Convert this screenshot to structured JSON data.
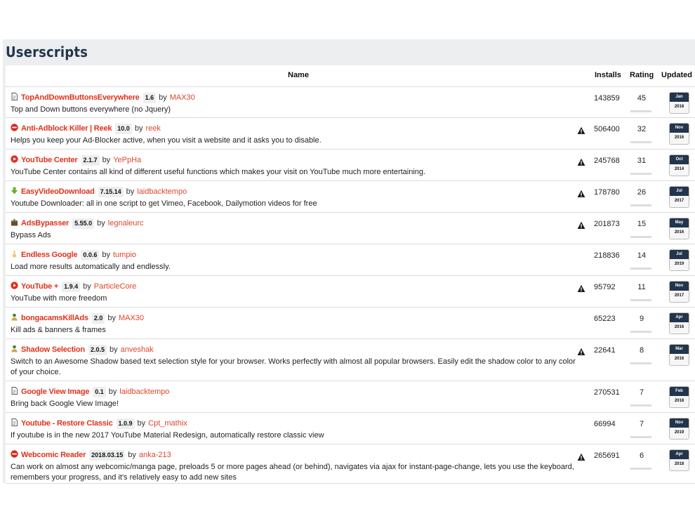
{
  "title": "Userscripts",
  "columns": {
    "name": "Name",
    "installs": "Installs",
    "rating": "Rating",
    "updated": "Updated"
  },
  "colors": {
    "link": "#e0311b",
    "header_bg": "#eceeef",
    "calendar": "#23354d"
  },
  "rows": [
    {
      "icon": "document-icon",
      "name": "TopAndDownButtonsEverywhere",
      "version": "1.6",
      "by": "by",
      "author": "MAX30",
      "desc": "Top and Down buttons everywhere (no Jquery)",
      "warning": false,
      "installs": "143859",
      "rating": "45",
      "month": "Jan",
      "year": "2018"
    },
    {
      "icon": "stop-sign-icon",
      "name": "Anti-Adblock Killer | Reek",
      "version": "10.0",
      "by": "by",
      "author": "reek",
      "desc": "Helps you keep your Ad-Blocker active, when you visit a website and it asks you to disable.",
      "warning": true,
      "installs": "506400",
      "rating": "32",
      "month": "Nov",
      "year": "2016"
    },
    {
      "icon": "youtube-icon",
      "name": "YouTube Center",
      "version": "2.1.7",
      "by": "by",
      "author": "YePpHa",
      "desc": "YouTube Center contains all kind of different useful functions which makes your visit on YouTube much more entertaining.",
      "warning": true,
      "installs": "245768",
      "rating": "31",
      "month": "Oct",
      "year": "2014"
    },
    {
      "icon": "download-arrow-icon",
      "name": "EasyVideoDownload",
      "version": "7.15.14",
      "by": "by",
      "author": "laidbacktempo",
      "desc": "Youtube Downloader: all in one script to get Vimeo, Facebook, Dailymotion videos for free",
      "warning": true,
      "installs": "178780",
      "rating": "26",
      "month": "Jul",
      "year": "2017"
    },
    {
      "icon": "package-icon",
      "name": "AdsBypasser",
      "version": "5.55.0",
      "by": "by",
      "author": "legnaleurc",
      "desc": "Bypass Ads",
      "warning": true,
      "installs": "201873",
      "rating": "15",
      "month": "May",
      "year": "2016"
    },
    {
      "icon": "finger-icon",
      "name": "Endless Google",
      "version": "0.0.6",
      "by": "by",
      "author": "tumpio",
      "desc": "Load more results automatically and endlessly.",
      "warning": false,
      "installs": "218836",
      "rating": "14",
      "month": "Jul",
      "year": "2019"
    },
    {
      "icon": "youtube-icon",
      "name": "YouTube +",
      "version": "1.9.4",
      "by": "by",
      "author": "ParticleCore",
      "desc": "YouTube with more freedom",
      "warning": true,
      "installs": "95792",
      "rating": "11",
      "month": "Nov",
      "year": "2017"
    },
    {
      "icon": "person-icon",
      "name": "bongacamsKillAds",
      "version": "2.0",
      "by": "by",
      "author": "MAX30",
      "desc": "Kill ads & banners & frames",
      "warning": false,
      "installs": "65223",
      "rating": "9",
      "month": "Apr",
      "year": "2016"
    },
    {
      "icon": "person-icon",
      "name": "Shadow Selection",
      "version": "2.0.5",
      "by": "by",
      "author": "anveshak",
      "desc": "Switch to an Awesome Shadow based text selection style for your browser. Works perfectly with almost all popular browsers. Easily edit the shadow color to any color of your choice.",
      "warning": true,
      "installs": "22641",
      "rating": "8",
      "month": "Mar",
      "year": "2016"
    },
    {
      "icon": "document-icon",
      "name": "Google View Image",
      "version": "0.1",
      "by": "by",
      "author": "laidbacktempo",
      "desc": "Bring back Google View Image!",
      "warning": false,
      "installs": "270531",
      "rating": "7",
      "month": "Feb",
      "year": "2018"
    },
    {
      "icon": "document-icon",
      "name": "Youtube - Restore Classic",
      "version": "1.0.9",
      "by": "by",
      "author": "Cpt_mathix",
      "desc": "If youtube is in the new 2017 YouTube Material Redesign, automatically restore classic view",
      "warning": false,
      "installs": "66994",
      "rating": "7",
      "month": "Nov",
      "year": "2019"
    },
    {
      "icon": "stop-sign-icon",
      "name": "Webcomic Reader",
      "version": "2018.03.15",
      "by": "by",
      "author": "anka-213",
      "desc": "Can work on almost any webcomic/manga page, preloads 5 or more pages ahead (or behind), navigates via ajax for instant-page-change, lets you use the keyboard, remembers your progress, and it's relatively easy to add new sites",
      "warning": true,
      "installs": "265691",
      "rating": "6",
      "month": "Apr",
      "year": "2018"
    }
  ]
}
